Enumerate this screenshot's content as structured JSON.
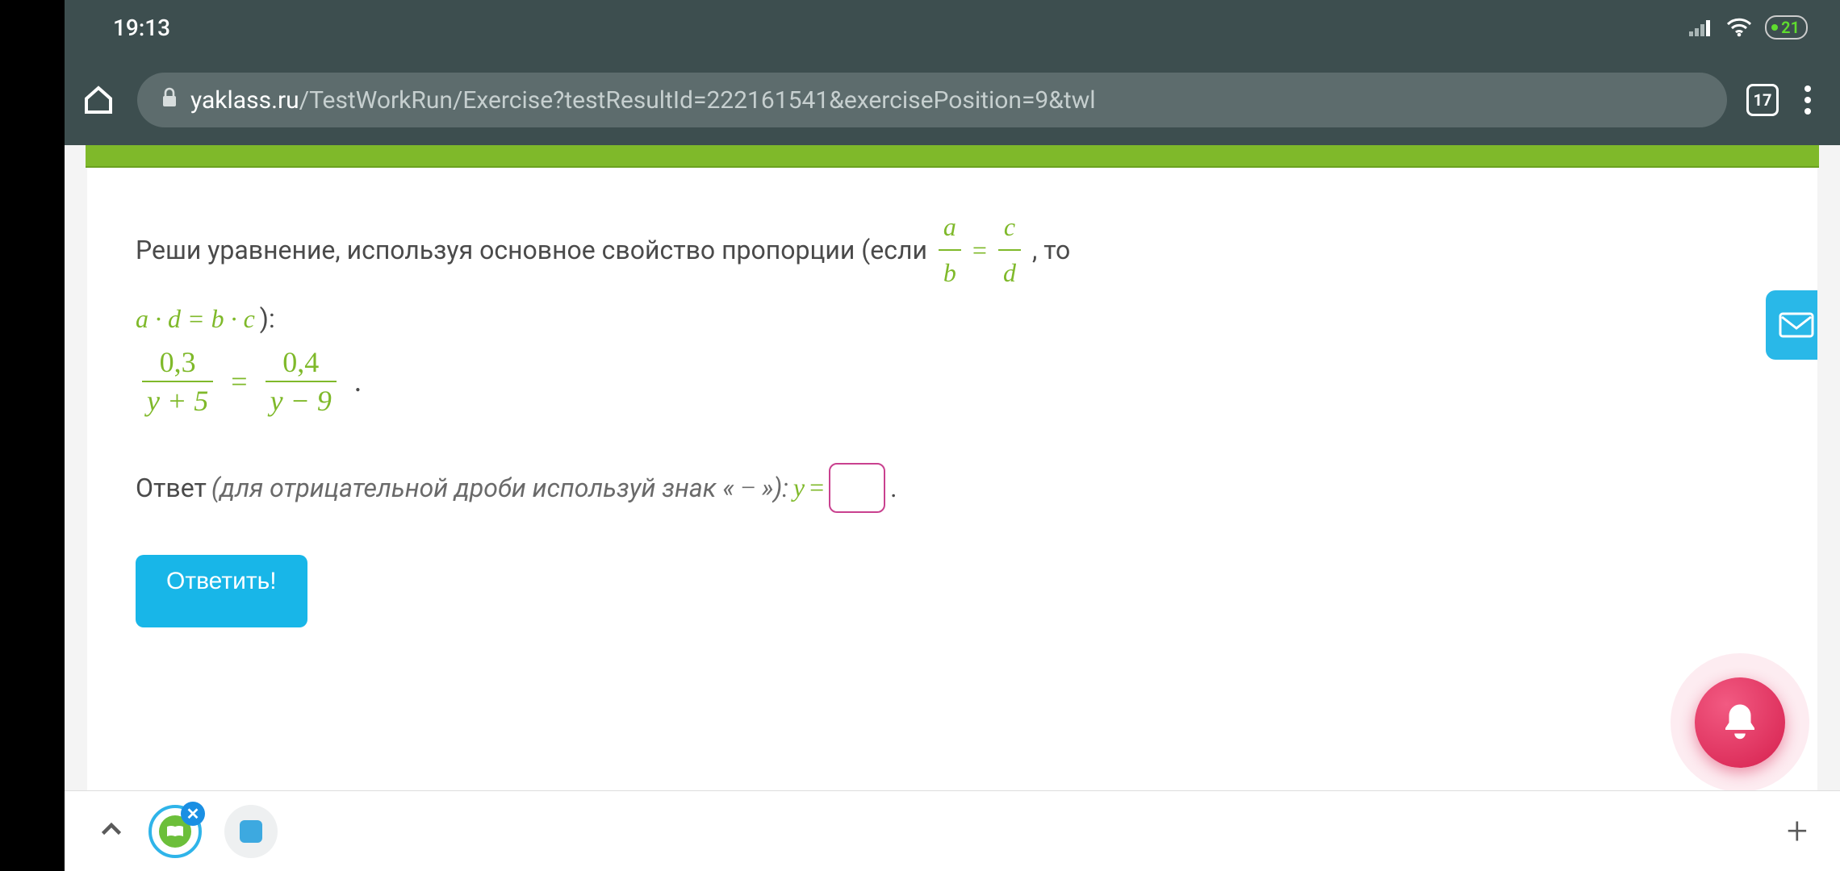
{
  "status": {
    "time": "19:13",
    "battery": "21"
  },
  "browser": {
    "domain": "yaklass.ru",
    "path": "/TestWorkRun/Exercise?testResultId=222161541&exercisePosition=9&twl",
    "tab_count": "17"
  },
  "problem": {
    "intro": "Реши уравнение, используя основное свойство пропорции (если",
    "frac1": {
      "num": "a",
      "den": "b"
    },
    "eq": "=",
    "frac2": {
      "num": "c",
      "den": "d"
    },
    "after_frac": ", то",
    "rule": "a · d = b · c",
    "rule_close": "):",
    "equation": {
      "left": {
        "num": "0,3",
        "den": "y + 5"
      },
      "right": {
        "num": "0,4",
        "den": "y − 9"
      }
    }
  },
  "answer": {
    "label": "Ответ",
    "hint_open": " (для отрицательной дроби используй знак «",
    "minus": "−",
    "hint_close": "»): ",
    "var": "y",
    "equals": " = ",
    "value": "",
    "period": "."
  },
  "submit_label": "Ответить!",
  "bottom": {
    "plus": "+"
  }
}
